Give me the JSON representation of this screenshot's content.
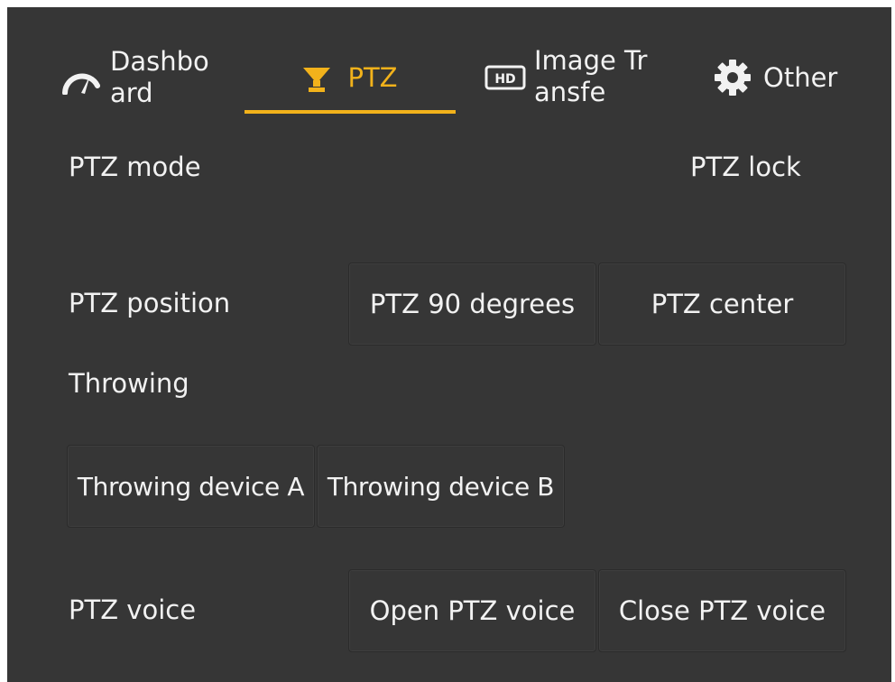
{
  "tabs": {
    "dashboard": {
      "label": "Dashboard",
      "icon": "speedometer-icon"
    },
    "ptz": {
      "label": "PTZ",
      "icon": "gimbal-icon",
      "active": true
    },
    "image": {
      "label": "Image Transfe",
      "icon": "hd-icon"
    },
    "other": {
      "label": "Other",
      "icon": "gear-icon"
    }
  },
  "rows": {
    "ptz_mode": {
      "label": "PTZ mode"
    },
    "ptz_lock": {
      "label": "PTZ lock"
    },
    "ptz_position": {
      "label": "PTZ position",
      "buttons": [
        "PTZ 90 degrees",
        "PTZ center"
      ]
    },
    "throwing": {
      "label": "Throwing",
      "buttons": [
        "Throwing device A",
        "Throwing device B"
      ]
    },
    "ptz_voice": {
      "label": "PTZ voice",
      "buttons": [
        "Open PTZ voice",
        "Close PTZ voice"
      ]
    }
  },
  "colors": {
    "background": "#363636",
    "accent": "#f2b21b",
    "text": "#f2f2f2"
  }
}
